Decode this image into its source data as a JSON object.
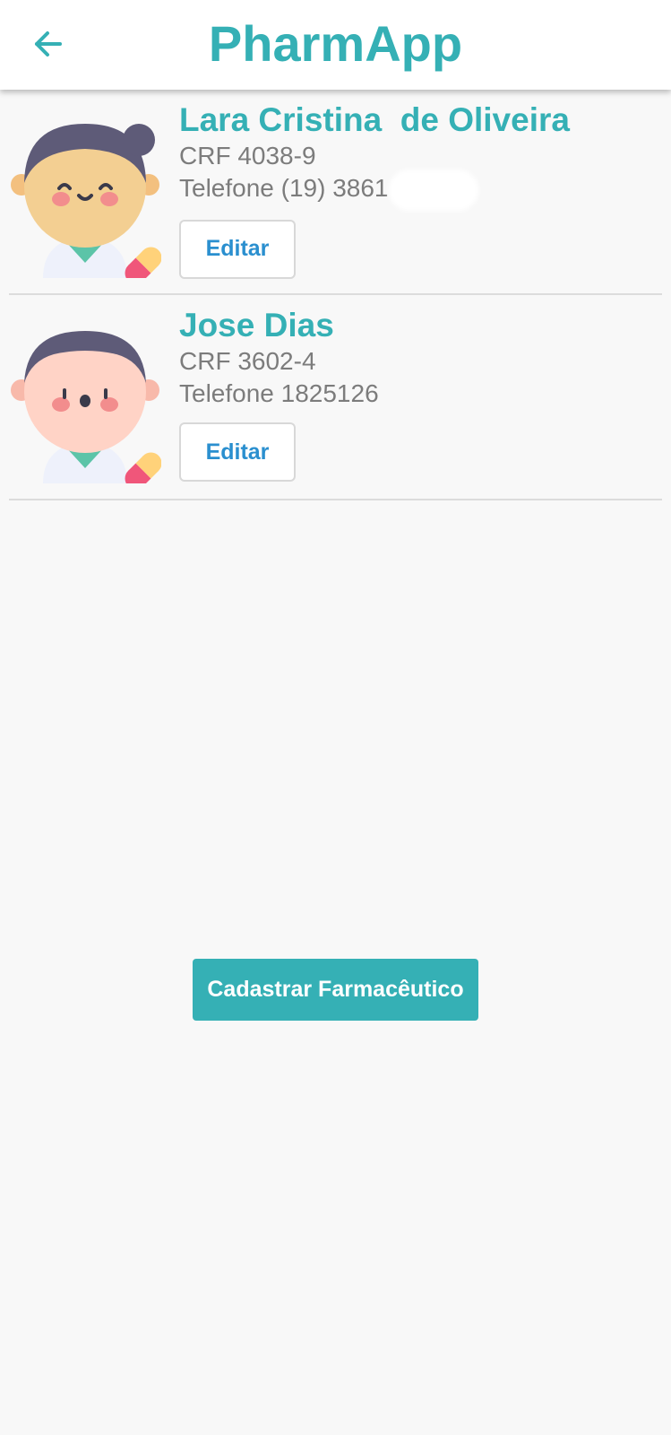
{
  "app": {
    "title": "PharmApp",
    "accent_color": "#35b0b5",
    "back_icon": "arrow-left-icon"
  },
  "pharmacists": [
    {
      "name": "Lara Cristina  de Oliveira",
      "crf": "CRF 4038-9",
      "phone": "Telefone (19) 3861",
      "phone_redacted": true,
      "avatar": "pharmacist-woman-avatar",
      "edit_label": "Editar"
    },
    {
      "name": "Jose Dias",
      "crf": "CRF 3602-4",
      "phone": "Telefone 1825126",
      "phone_redacted": false,
      "avatar": "pharmacist-man-avatar",
      "edit_label": "Editar"
    }
  ],
  "actions": {
    "register_label": "Cadastrar Farmacêutico"
  }
}
